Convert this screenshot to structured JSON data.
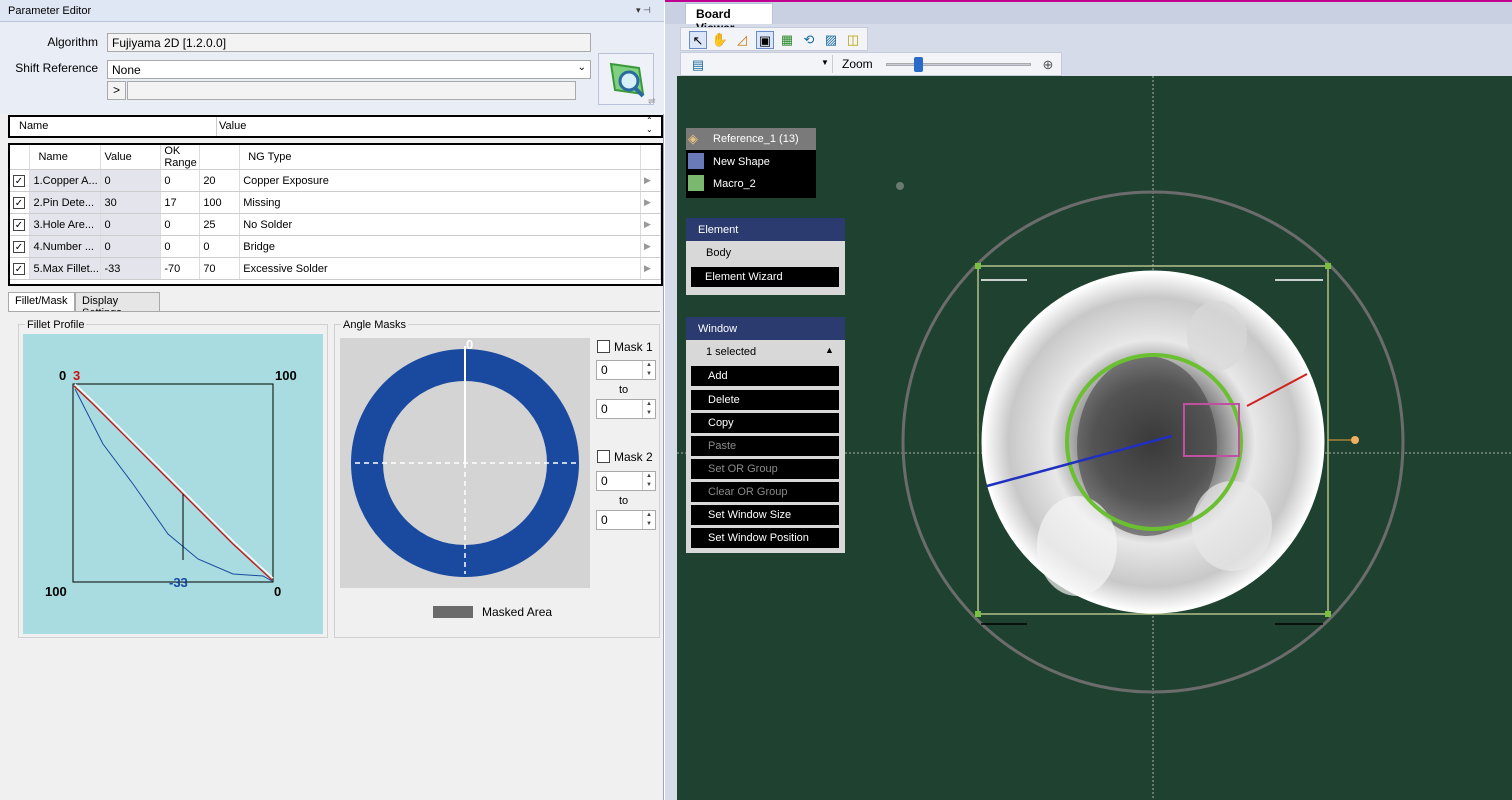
{
  "left_panel": {
    "title": "Parameter Editor",
    "title_icons": "▾ ⊣",
    "algorithm_label": "Algorithm",
    "algorithm_value": "Fujiyama 2D [1.2.0.0]",
    "shift_label": "Shift Reference",
    "shift_value": "None",
    "expand_button": ">",
    "param_grid": {
      "col_name": "Name",
      "col_value": "Value"
    },
    "table": {
      "headers": [
        "Name",
        "Value",
        "OK Range",
        "NG Type"
      ],
      "rows": [
        {
          "checked": "✓",
          "name": "1.Copper A...",
          "value": "0",
          "ok_min": "0",
          "ok_max": "20",
          "ng_type": "Copper Exposure"
        },
        {
          "checked": "✓",
          "name": "2.Pin Dete...",
          "value": "30",
          "ok_min": "17",
          "ok_max": "100",
          "ng_type": "Missing"
        },
        {
          "checked": "✓",
          "name": "3.Hole Are...",
          "value": "0",
          "ok_min": "0",
          "ok_max": "25",
          "ng_type": "No Solder"
        },
        {
          "checked": "✓",
          "name": "4.Number ...",
          "value": "0",
          "ok_min": "0",
          "ok_max": "0",
          "ng_type": "Bridge"
        },
        {
          "checked": "✓",
          "name": "5.Max Fillet...",
          "value": "-33",
          "ok_min": "-70",
          "ok_max": "70",
          "ng_type": "Excessive Solder"
        }
      ]
    },
    "tabs": [
      "Fillet/Mask",
      "Display Settings"
    ],
    "fillet_profile": {
      "title": "Fillet Profile",
      "top_left": "0",
      "top_red": "3",
      "top_right": "100",
      "bottom_left": "100",
      "bottom_blue": "-33",
      "bottom_right": "0"
    },
    "angle_masks": {
      "title": "Angle Masks",
      "top_label": "0",
      "mask1_label": "Mask 1",
      "mask1_from": "0",
      "mask1_to_label": "to",
      "mask1_to": "0",
      "mask2_label": "Mask 2",
      "mask2_from": "0",
      "mask2_to_label": "to",
      "mask2_to": "0",
      "legend": "Masked Area"
    }
  },
  "board_viewer": {
    "tab_label": "Board Viewer",
    "zoom_label": "Zoom",
    "zoom_level": 0.2,
    "layers": [
      {
        "label": "Reference_1 (13)"
      },
      {
        "label": "New Shape"
      },
      {
        "label": "Macro_2"
      }
    ],
    "element_menu": {
      "header": "Element",
      "items": [
        "Body",
        "Element Wizard"
      ]
    },
    "window_menu": {
      "header": "Window",
      "selected": "1 selected",
      "buttons": [
        "Add",
        "Delete",
        "Copy",
        "Paste",
        "Set OR Group",
        "Clear OR Group",
        "Set Window Size",
        "Set Window Position"
      ]
    }
  },
  "colors": {
    "accent_blue": "#1a4aa0",
    "menu_header": "#2b3b70",
    "board_green": "#1f4230",
    "fillet_bg": "#a8dce0",
    "title_pink": "#c00090"
  }
}
